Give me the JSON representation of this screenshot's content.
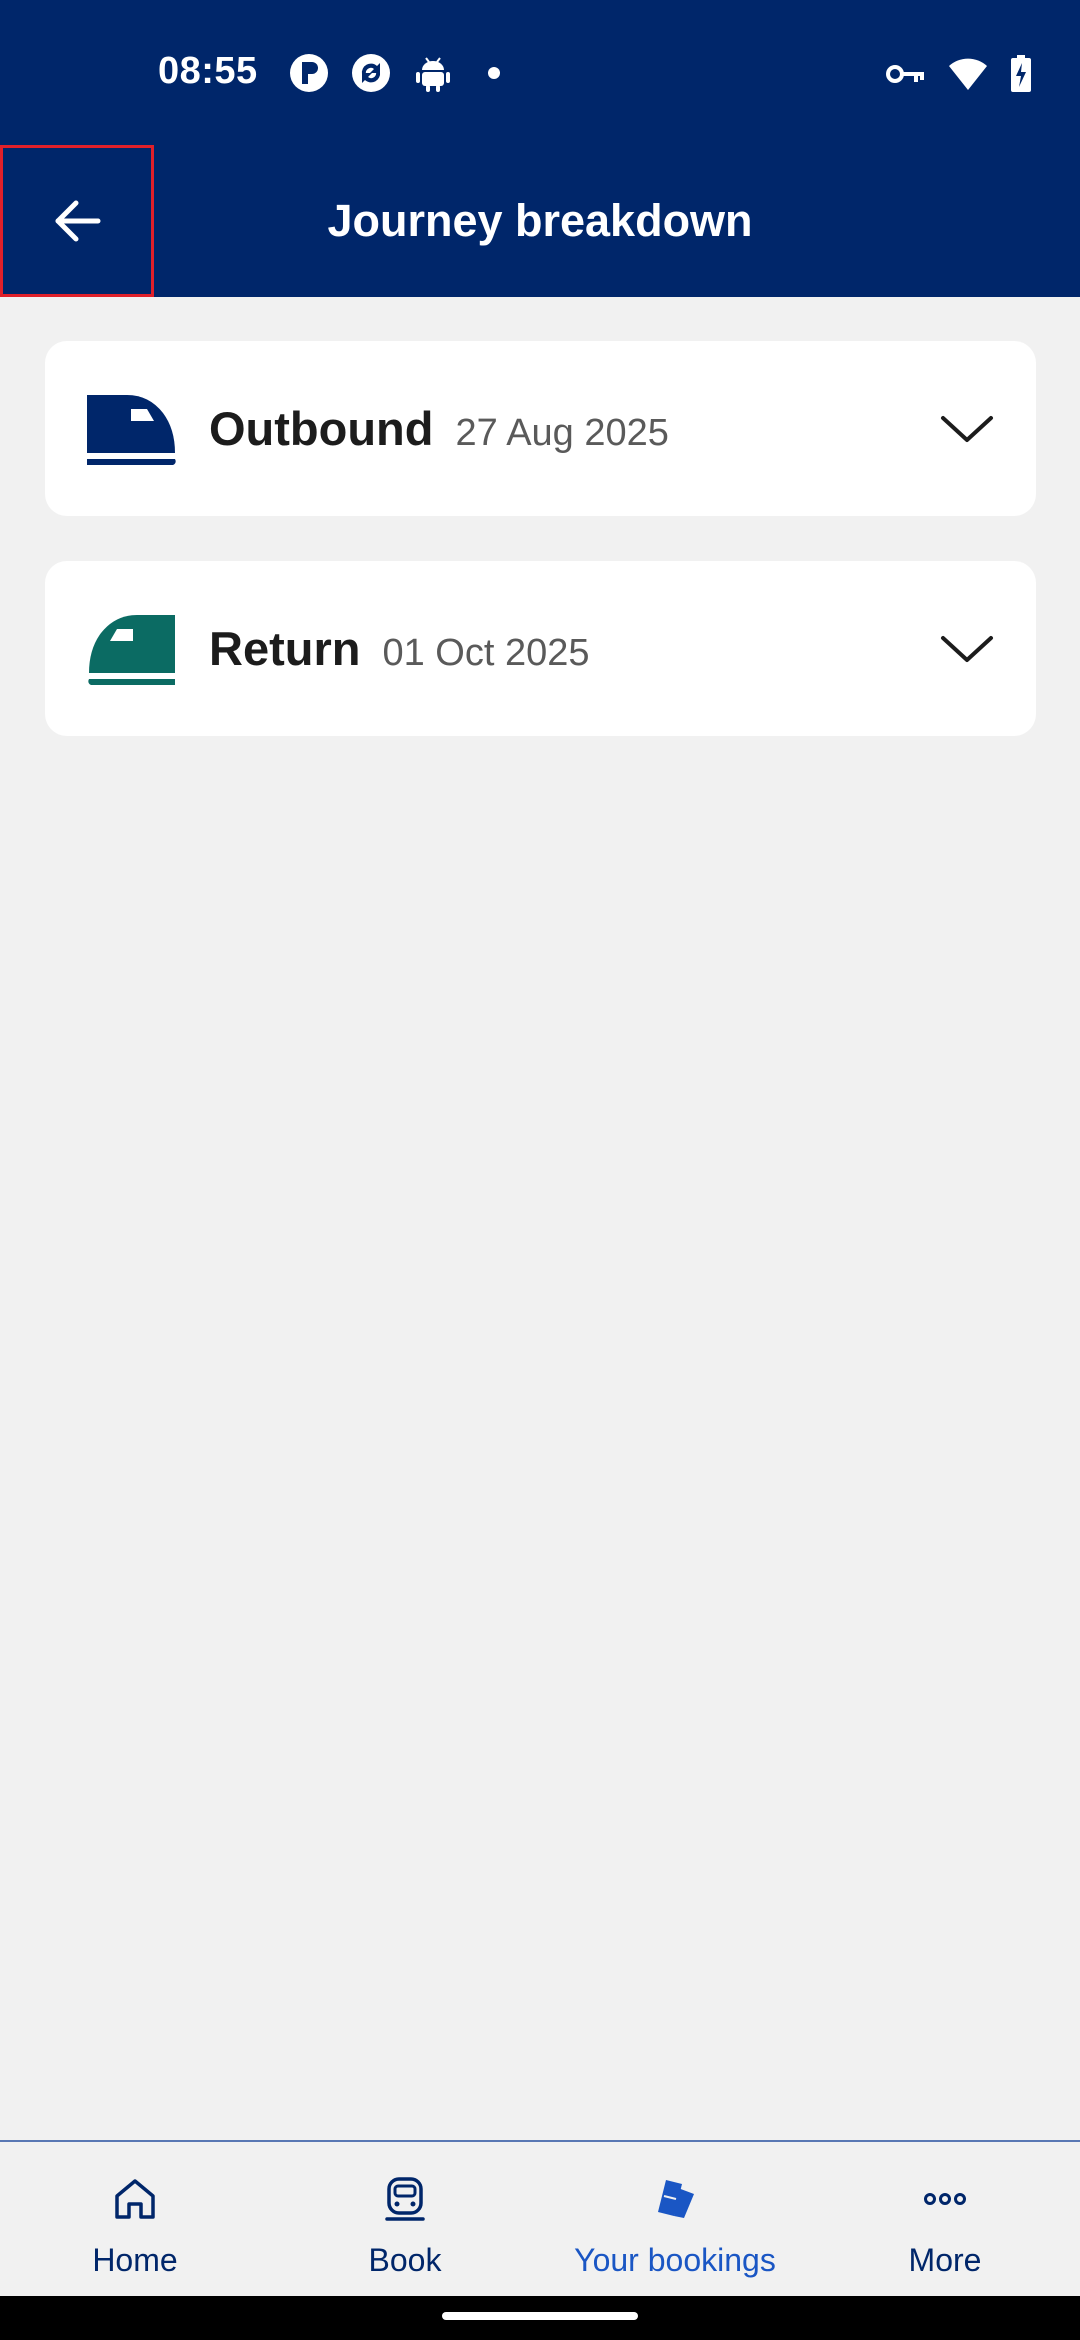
{
  "status_bar": {
    "time": "08:55",
    "left_icons": [
      "app-p-icon",
      "sync-app-icon",
      "android-icon",
      "notification-dot-icon"
    ],
    "right_icons": [
      "vpn-key-icon",
      "wifi-icon",
      "battery-charging-icon"
    ]
  },
  "header": {
    "title": "Journey breakdown",
    "back_icon": "arrow-left-icon",
    "background_color": "#00266a"
  },
  "journeys": [
    {
      "label": "Outbound",
      "date": "27 Aug 2025",
      "icon": "train-icon",
      "icon_color": "#00266a"
    },
    {
      "label": "Return",
      "date": "01 Oct 2025",
      "icon": "train-icon",
      "icon_color": "#0b6b63"
    }
  ],
  "bottom_nav": {
    "items": [
      {
        "label": "Home",
        "icon": "home-icon",
        "active": false
      },
      {
        "label": "Book",
        "icon": "train-front-icon",
        "active": false
      },
      {
        "label": "Your bookings",
        "icon": "tickets-icon",
        "active": true
      },
      {
        "label": "More",
        "icon": "more-dots-icon",
        "active": false
      }
    ],
    "active_color": "#1a56c4",
    "inactive_color": "#00266a"
  }
}
